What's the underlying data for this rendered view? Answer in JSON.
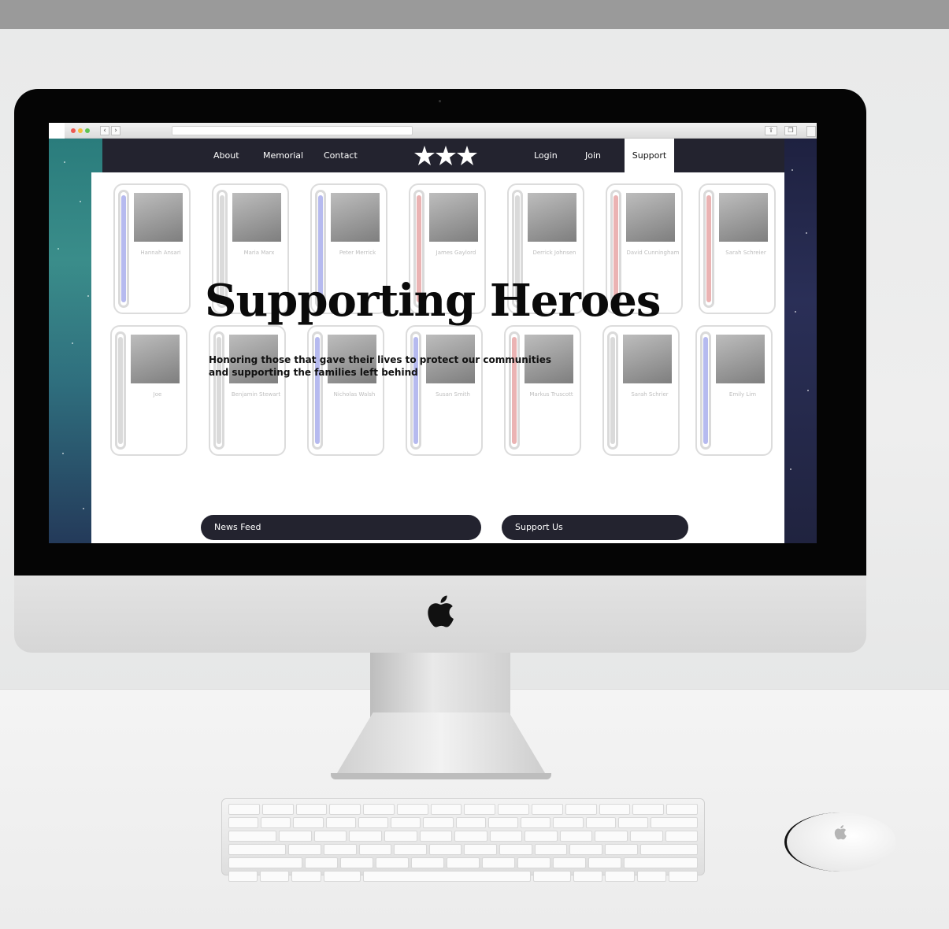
{
  "browser": {
    "back_glyph": "‹",
    "forward_glyph": "›",
    "share_glyph": "⇪",
    "tabs_glyph": "❐"
  },
  "nav": {
    "about": "About",
    "memorial": "Memorial",
    "contact": "Contact",
    "login": "Login",
    "join": "Join",
    "support": "Support",
    "logo_icon": "three-stars-icon"
  },
  "hero": {
    "title": "Supporting Heroes",
    "subtitle_line1": "Honoring those that gave their lives to protect our communities",
    "subtitle_line2": "and supporting the families left behind"
  },
  "cards": [
    {
      "name": "Hannah Ansari",
      "bar": "#8f95e6"
    },
    {
      "name": "Maria Marx",
      "bar": "#c6c6c6"
    },
    {
      "name": "Peter Merrick",
      "bar": "#8f95e6"
    },
    {
      "name": "James Gaylord",
      "bar": "#e08a8a"
    },
    {
      "name": "Derrick Johnsen",
      "bar": "#c6c6c6"
    },
    {
      "name": "David Cunningham",
      "bar": "#e08a8a"
    },
    {
      "name": "Sarah Schreier",
      "bar": "#e08a8a"
    },
    {
      "name": "Joe",
      "bar": "#c6c6c6"
    },
    {
      "name": "Benjamin Stewart",
      "bar": "#c6c6c6"
    },
    {
      "name": "Nicholas Walsh",
      "bar": "#8f95e6"
    },
    {
      "name": "Susan Smith",
      "bar": "#8f95e6"
    },
    {
      "name": "Markus Truscott",
      "bar": "#e08a8a"
    },
    {
      "name": "Sarah Schrier",
      "bar": "#c6c6c6"
    },
    {
      "name": "Emily Lim",
      "bar": "#8f95e6"
    }
  ],
  "buttons": {
    "news_feed": "News Feed",
    "support_us": "Support Us"
  },
  "colors": {
    "nav_bg": "#23232f",
    "accent_blue": "#8f95e6",
    "accent_red": "#e08a8a"
  }
}
